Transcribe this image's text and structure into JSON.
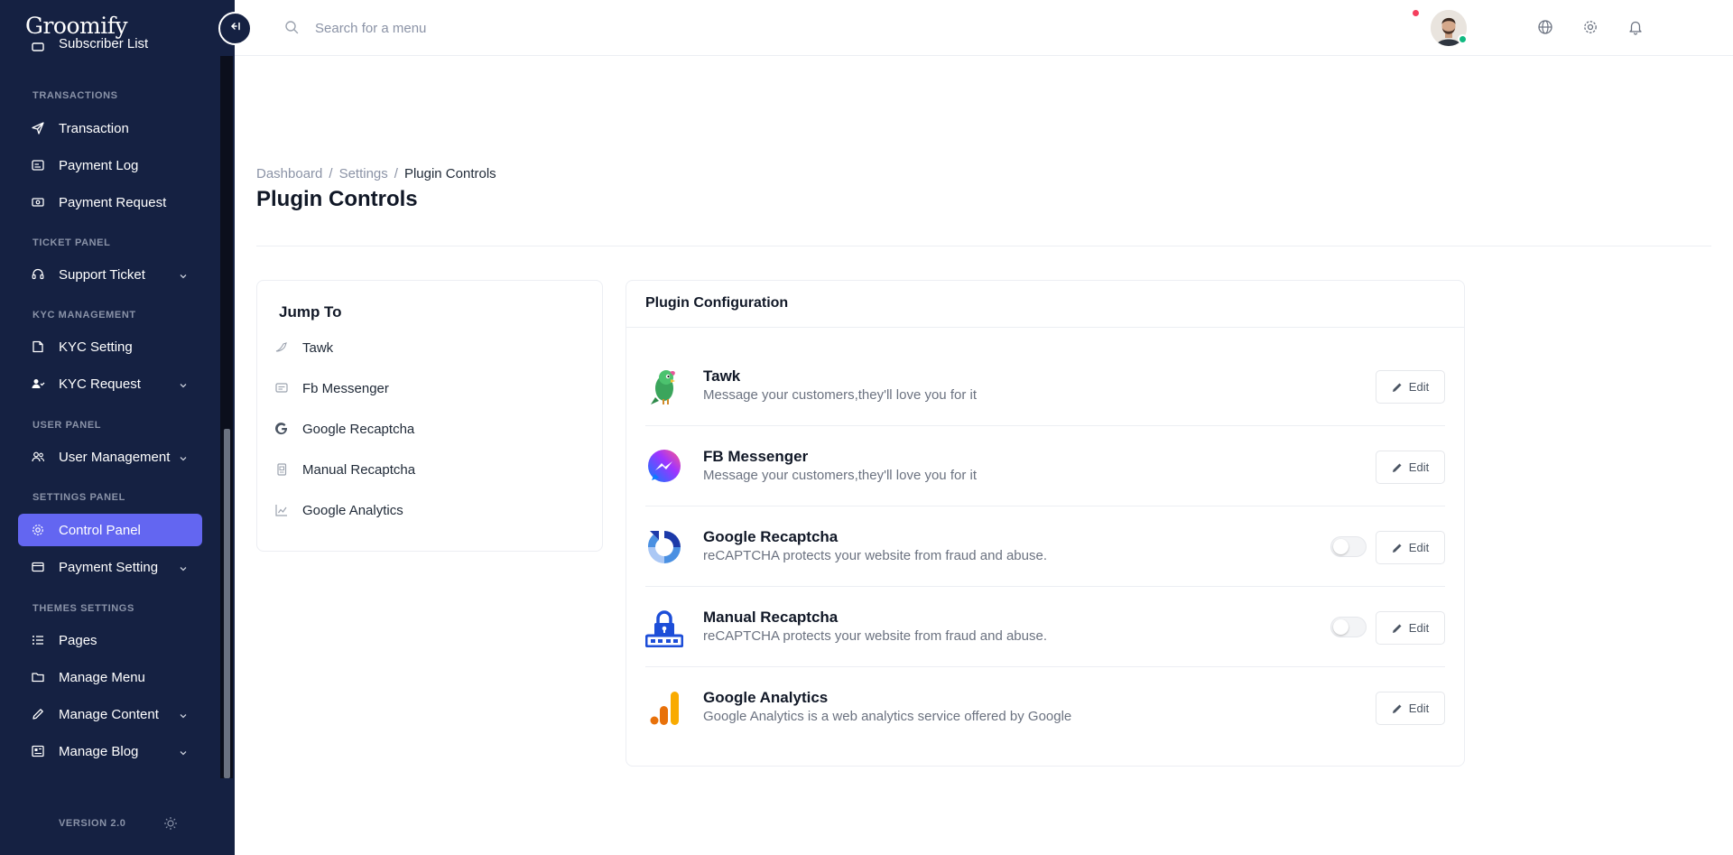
{
  "app": {
    "logo_text": "Groomify"
  },
  "search": {
    "placeholder": "Search for a menu"
  },
  "sidebar": {
    "partial_item": "Subscriber List",
    "sections": {
      "transactions": "TRANSACTIONS",
      "ticket": "TICKET PANEL",
      "kyc": "KYC MANAGEMENT",
      "user": "USER PANEL",
      "settings": "SETTINGS PANEL",
      "themes": "THEMES SETTINGS"
    },
    "items": {
      "transaction": "Transaction",
      "payment_log": "Payment Log",
      "payment_request": "Payment Request",
      "support_ticket": "Support Ticket",
      "kyc_setting": "KYC Setting",
      "kyc_request": "KYC Request",
      "user_management": "User Management",
      "control_panel": "Control Panel",
      "payment_setting": "Payment Setting",
      "pages": "Pages",
      "manage_menu": "Manage Menu",
      "manage_content": "Manage Content",
      "manage_blog": "Manage Blog"
    },
    "version": "VERSION 2.0",
    "active_color": "#6366f1",
    "bg_color": "#152142"
  },
  "breadcrumb": {
    "home": "Dashboard",
    "parent": "Settings",
    "current": "Plugin Controls",
    "separator": "/"
  },
  "page": {
    "title": "Plugin Controls"
  },
  "jump_to": {
    "title": "Jump To",
    "items": {
      "tawk": "Tawk",
      "fb": "Fb Messenger",
      "google_recaptcha": "Google Recaptcha",
      "manual_recaptcha": "Manual Recaptcha",
      "google_analytics": "Google Analytics"
    }
  },
  "plugins": {
    "header": "Plugin Configuration",
    "edit_label": "Edit",
    "tawk": {
      "name": "Tawk",
      "desc": "Message your customers,they'll love you for it"
    },
    "fb": {
      "name": "FB Messenger",
      "desc": "Message your customers,they'll love you for it"
    },
    "google_recaptcha": {
      "name": "Google Recaptcha",
      "desc": "reCAPTCHA protects your website from fraud and abuse.",
      "enabled": false
    },
    "manual_recaptcha": {
      "name": "Manual Recaptcha",
      "desc": "reCAPTCHA protects your website from fraud and abuse.",
      "enabled": false
    },
    "google_analytics": {
      "name": "Google Analytics",
      "desc": "Google Analytics is a web analytics service offered by Google"
    }
  },
  "icons": [
    "globe-icon",
    "gear-icon",
    "bell-icon",
    "search-icon",
    "collapse-sidebar-icon",
    "sun-icon"
  ]
}
